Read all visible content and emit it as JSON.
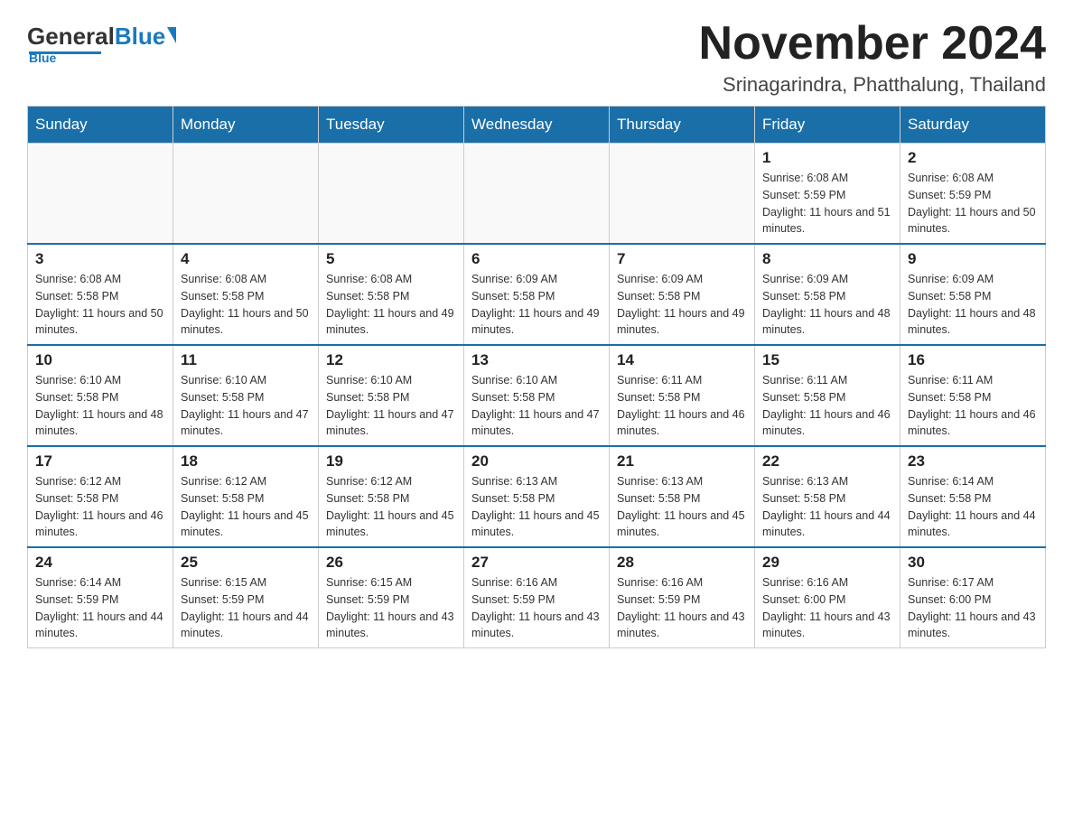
{
  "logo": {
    "general": "General",
    "blue": "Blue",
    "underline": "Blue"
  },
  "title": "November 2024",
  "subtitle": "Srinagarindra, Phatthalung, Thailand",
  "weekdays": [
    "Sunday",
    "Monday",
    "Tuesday",
    "Wednesday",
    "Thursday",
    "Friday",
    "Saturday"
  ],
  "weeks": [
    [
      {
        "day": "",
        "info": ""
      },
      {
        "day": "",
        "info": ""
      },
      {
        "day": "",
        "info": ""
      },
      {
        "day": "",
        "info": ""
      },
      {
        "day": "",
        "info": ""
      },
      {
        "day": "1",
        "info": "Sunrise: 6:08 AM\nSunset: 5:59 PM\nDaylight: 11 hours and 51 minutes."
      },
      {
        "day": "2",
        "info": "Sunrise: 6:08 AM\nSunset: 5:59 PM\nDaylight: 11 hours and 50 minutes."
      }
    ],
    [
      {
        "day": "3",
        "info": "Sunrise: 6:08 AM\nSunset: 5:58 PM\nDaylight: 11 hours and 50 minutes."
      },
      {
        "day": "4",
        "info": "Sunrise: 6:08 AM\nSunset: 5:58 PM\nDaylight: 11 hours and 50 minutes."
      },
      {
        "day": "5",
        "info": "Sunrise: 6:08 AM\nSunset: 5:58 PM\nDaylight: 11 hours and 49 minutes."
      },
      {
        "day": "6",
        "info": "Sunrise: 6:09 AM\nSunset: 5:58 PM\nDaylight: 11 hours and 49 minutes."
      },
      {
        "day": "7",
        "info": "Sunrise: 6:09 AM\nSunset: 5:58 PM\nDaylight: 11 hours and 49 minutes."
      },
      {
        "day": "8",
        "info": "Sunrise: 6:09 AM\nSunset: 5:58 PM\nDaylight: 11 hours and 48 minutes."
      },
      {
        "day": "9",
        "info": "Sunrise: 6:09 AM\nSunset: 5:58 PM\nDaylight: 11 hours and 48 minutes."
      }
    ],
    [
      {
        "day": "10",
        "info": "Sunrise: 6:10 AM\nSunset: 5:58 PM\nDaylight: 11 hours and 48 minutes."
      },
      {
        "day": "11",
        "info": "Sunrise: 6:10 AM\nSunset: 5:58 PM\nDaylight: 11 hours and 47 minutes."
      },
      {
        "day": "12",
        "info": "Sunrise: 6:10 AM\nSunset: 5:58 PM\nDaylight: 11 hours and 47 minutes."
      },
      {
        "day": "13",
        "info": "Sunrise: 6:10 AM\nSunset: 5:58 PM\nDaylight: 11 hours and 47 minutes."
      },
      {
        "day": "14",
        "info": "Sunrise: 6:11 AM\nSunset: 5:58 PM\nDaylight: 11 hours and 46 minutes."
      },
      {
        "day": "15",
        "info": "Sunrise: 6:11 AM\nSunset: 5:58 PM\nDaylight: 11 hours and 46 minutes."
      },
      {
        "day": "16",
        "info": "Sunrise: 6:11 AM\nSunset: 5:58 PM\nDaylight: 11 hours and 46 minutes."
      }
    ],
    [
      {
        "day": "17",
        "info": "Sunrise: 6:12 AM\nSunset: 5:58 PM\nDaylight: 11 hours and 46 minutes."
      },
      {
        "day": "18",
        "info": "Sunrise: 6:12 AM\nSunset: 5:58 PM\nDaylight: 11 hours and 45 minutes."
      },
      {
        "day": "19",
        "info": "Sunrise: 6:12 AM\nSunset: 5:58 PM\nDaylight: 11 hours and 45 minutes."
      },
      {
        "day": "20",
        "info": "Sunrise: 6:13 AM\nSunset: 5:58 PM\nDaylight: 11 hours and 45 minutes."
      },
      {
        "day": "21",
        "info": "Sunrise: 6:13 AM\nSunset: 5:58 PM\nDaylight: 11 hours and 45 minutes."
      },
      {
        "day": "22",
        "info": "Sunrise: 6:13 AM\nSunset: 5:58 PM\nDaylight: 11 hours and 44 minutes."
      },
      {
        "day": "23",
        "info": "Sunrise: 6:14 AM\nSunset: 5:58 PM\nDaylight: 11 hours and 44 minutes."
      }
    ],
    [
      {
        "day": "24",
        "info": "Sunrise: 6:14 AM\nSunset: 5:59 PM\nDaylight: 11 hours and 44 minutes."
      },
      {
        "day": "25",
        "info": "Sunrise: 6:15 AM\nSunset: 5:59 PM\nDaylight: 11 hours and 44 minutes."
      },
      {
        "day": "26",
        "info": "Sunrise: 6:15 AM\nSunset: 5:59 PM\nDaylight: 11 hours and 43 minutes."
      },
      {
        "day": "27",
        "info": "Sunrise: 6:16 AM\nSunset: 5:59 PM\nDaylight: 11 hours and 43 minutes."
      },
      {
        "day": "28",
        "info": "Sunrise: 6:16 AM\nSunset: 5:59 PM\nDaylight: 11 hours and 43 minutes."
      },
      {
        "day": "29",
        "info": "Sunrise: 6:16 AM\nSunset: 6:00 PM\nDaylight: 11 hours and 43 minutes."
      },
      {
        "day": "30",
        "info": "Sunrise: 6:17 AM\nSunset: 6:00 PM\nDaylight: 11 hours and 43 minutes."
      }
    ]
  ]
}
